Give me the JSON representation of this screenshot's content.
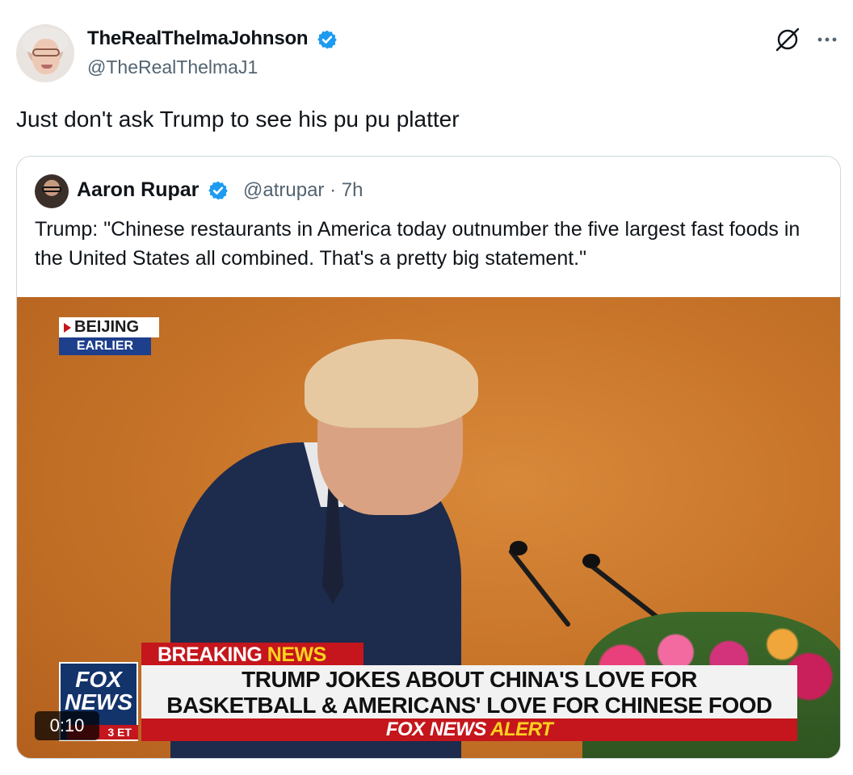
{
  "post": {
    "author_name": "TheRealThelmaJohnson",
    "author_handle": "@TheRealThelmaJ1",
    "text": "Just don't ask Trump to see his pu pu platter"
  },
  "quoted_post": {
    "author_name": "Aaron Rupar",
    "author_handle_time": "@atrupar · 7h",
    "text": "Trump: \"Chinese restaurants in America today outnumber the five largest fast foods in the United States all combined. That's a pretty big statement.\""
  },
  "video": {
    "duration": "0:10",
    "location_badge": {
      "top": "BEIJING",
      "bottom": "EARLIER"
    },
    "breaking_prefix": "BREAKING ",
    "breaking_news": "NEWS",
    "headline_line1": "TRUMP JOKES ABOUT CHINA'S LOVE FOR",
    "headline_line2": "BASKETBALL & AMERICANS' LOVE FOR CHINESE FOOD",
    "alert_brand": "FOX NEWS ",
    "alert_word": "ALERT",
    "logo_line1": "FOX",
    "logo_line2": "NEWS",
    "logo_time": "3 ET"
  },
  "colors": {
    "verified_blue": "#1d9bf0",
    "fox_red": "#c4161c",
    "fox_navy": "#13336b",
    "fox_yellow": "#ffd21f"
  },
  "icons": {
    "verified": "verified-badge-icon",
    "grok": "grok-icon",
    "more": "more-options-icon"
  }
}
